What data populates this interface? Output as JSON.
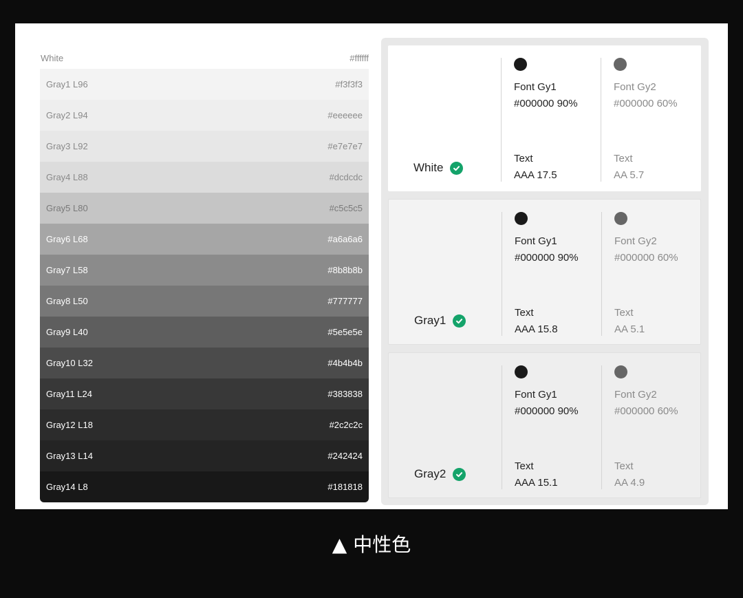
{
  "palette": {
    "rows": [
      {
        "name": "White",
        "hex": "#ffffff",
        "bg": "#ffffff",
        "fg": "#8a8a8a"
      },
      {
        "name": "Gray1 L96",
        "hex": "#f3f3f3",
        "bg": "#f3f3f3",
        "fg": "#8a8a8a"
      },
      {
        "name": "Gray2 L94",
        "hex": "#eeeeee",
        "bg": "#eeeeee",
        "fg": "#8a8a8a"
      },
      {
        "name": "Gray3 L92",
        "hex": "#e7e7e7",
        "bg": "#e7e7e7",
        "fg": "#8a8a8a"
      },
      {
        "name": "Gray4 L88",
        "hex": "#dcdcdc",
        "bg": "#dcdcdc",
        "fg": "#8a8a8a"
      },
      {
        "name": "Gray5 L80",
        "hex": "#c5c5c5",
        "bg": "#c5c5c5",
        "fg": "#7a7a7a"
      },
      {
        "name": "Gray6 L68",
        "hex": "#a6a6a6",
        "bg": "#a6a6a6",
        "fg": "#ffffff"
      },
      {
        "name": "Gray7 L58",
        "hex": "#8b8b8b",
        "bg": "#8b8b8b",
        "fg": "#ffffff"
      },
      {
        "name": "Gray8 L50",
        "hex": "#777777",
        "bg": "#777777",
        "fg": "#ffffff"
      },
      {
        "name": "Gray9 L40",
        "hex": "#5e5e5e",
        "bg": "#5e5e5e",
        "fg": "#ffffff"
      },
      {
        "name": "Gray10 L32",
        "hex": "#4b4b4b",
        "bg": "#4b4b4b",
        "fg": "#ffffff"
      },
      {
        "name": "Gray11 L24",
        "hex": "#383838",
        "bg": "#383838",
        "fg": "#ffffff"
      },
      {
        "name": "Gray12 L18",
        "hex": "#2c2c2c",
        "bg": "#2c2c2c",
        "fg": "#ffffff"
      },
      {
        "name": "Gray13 L14",
        "hex": "#242424",
        "bg": "#242424",
        "fg": "#ffffff"
      },
      {
        "name": "Gray14 L8",
        "hex": "#181818",
        "bg": "#181818",
        "fg": "#ffffff"
      }
    ]
  },
  "cards": [
    {
      "label": "White",
      "bg": "#ffffff",
      "gy1": {
        "name": "Font Gy1",
        "spec": "#000000 90%",
        "text": "Text",
        "rating": "AAA 17.5"
      },
      "gy2": {
        "name": "Font Gy2",
        "spec": "#000000 60%",
        "text": "Text",
        "rating": "AA 5.7"
      }
    },
    {
      "label": "Gray1",
      "bg": "#f3f3f3",
      "gy1": {
        "name": "Font Gy1",
        "spec": "#000000 90%",
        "text": "Text",
        "rating": "AAA 15.8"
      },
      "gy2": {
        "name": "Font Gy2",
        "spec": "#000000 60%",
        "text": "Text",
        "rating": "AA 5.1"
      }
    },
    {
      "label": "Gray2",
      "bg": "#eeeeee",
      "gy1": {
        "name": "Font Gy1",
        "spec": "#000000 90%",
        "text": "Text",
        "rating": "AAA 15.1"
      },
      "gy2": {
        "name": "Font Gy2",
        "spec": "#000000 60%",
        "text": "Text",
        "rating": "AA 4.9"
      }
    }
  ],
  "colors": {
    "gy1": "#1a1a1a",
    "gy2": "#666666",
    "check": "#14a36a"
  },
  "caption": "▲ 中性色"
}
